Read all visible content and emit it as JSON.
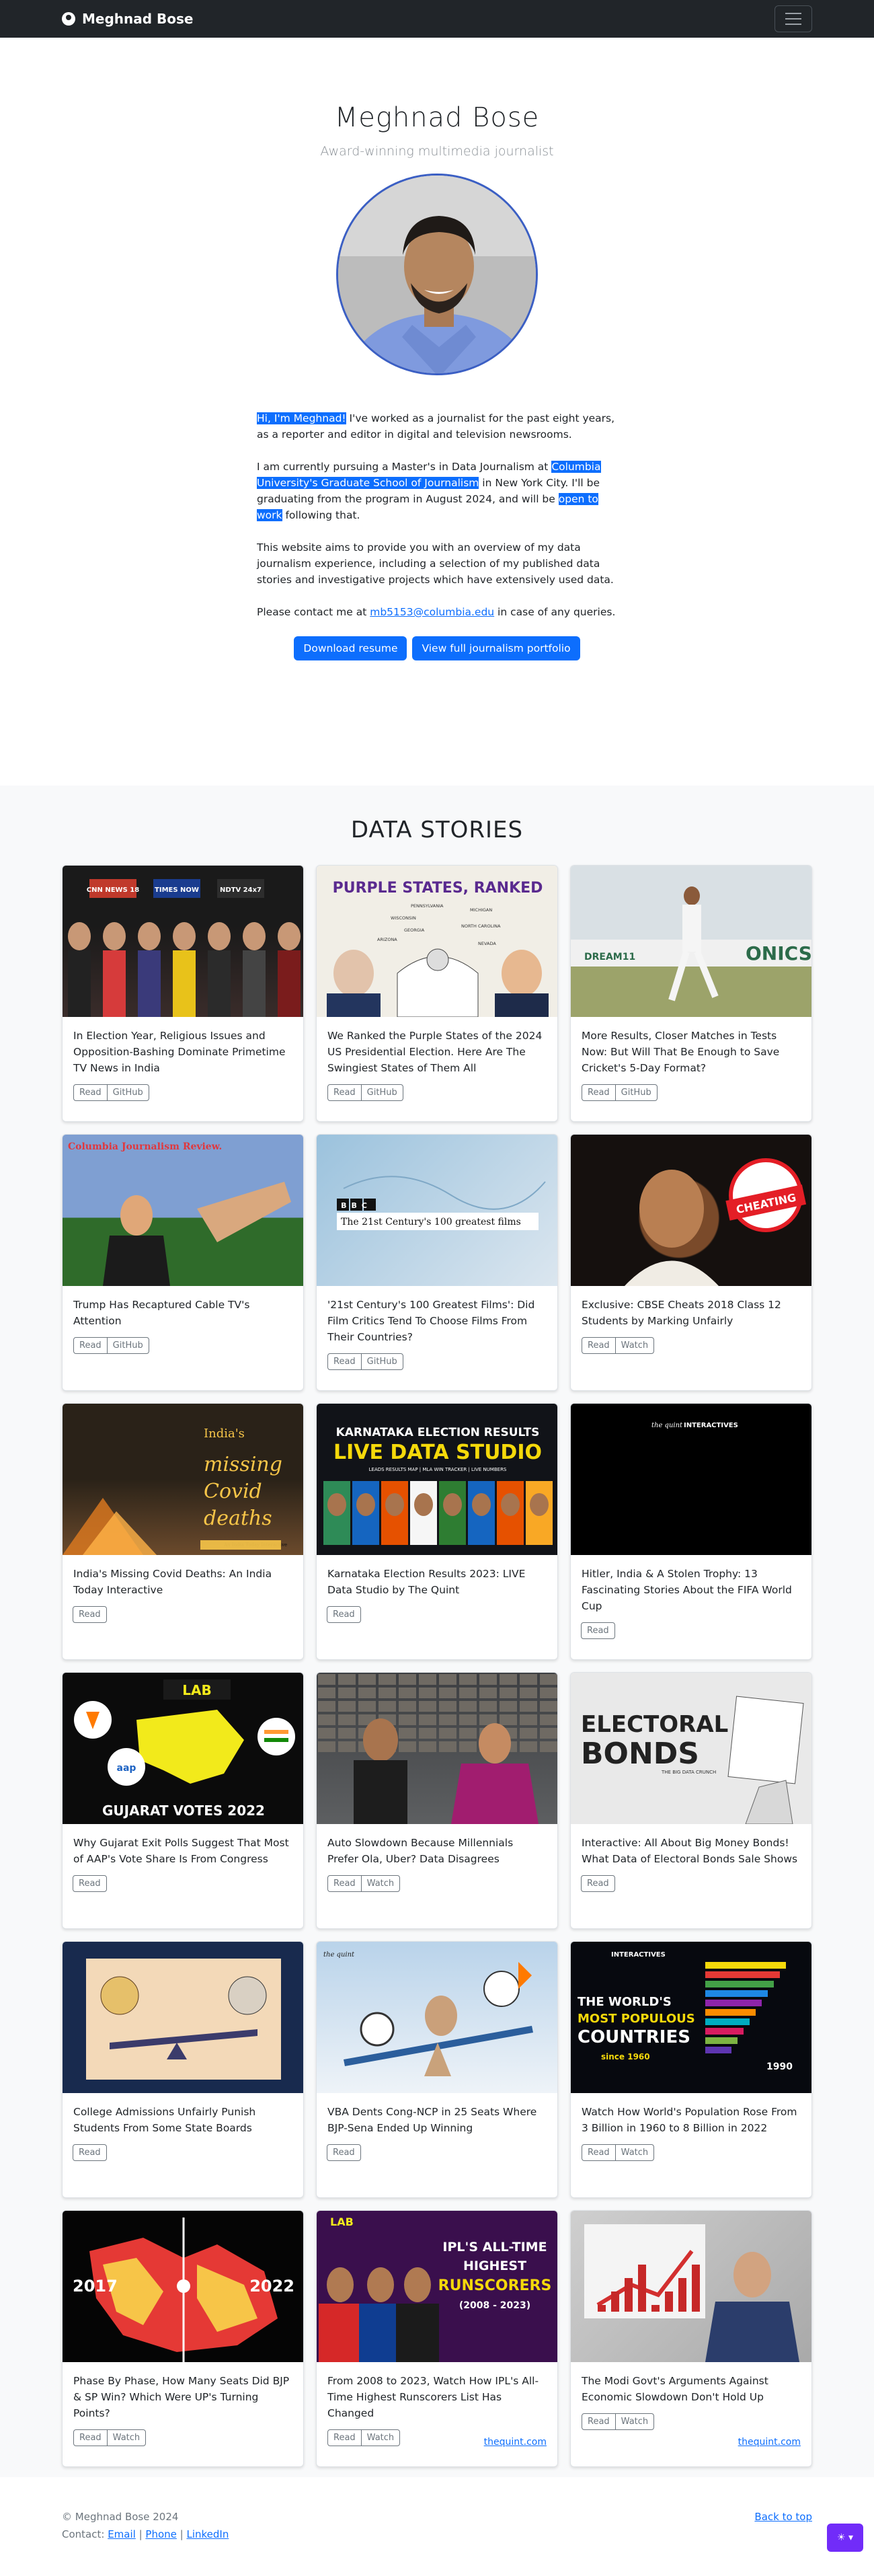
{
  "nav": {
    "brand": "Meghnad Bose"
  },
  "hero": {
    "name": "Meghnad Bose",
    "subtitle": "Award-winning multimedia journalist",
    "bio": {
      "p1_hl": "Hi, I'm Meghnad!",
      "p1_rest": " I've worked as a journalist for the past eight years, as a reporter and editor in digital and television newsrooms.",
      "p2_a": "I am currently pursuing a Master's in Data Journalism at ",
      "p2_hl1": "Columbia University's Graduate School of Journalism",
      "p2_b": " in New York City. I'll be graduating from the program in August 2024, and will be ",
      "p2_hl2": "open to work",
      "p2_c": " following that.",
      "p3": "This website aims to provide you with an overview of my data journalism experience, including a selection of my published data stories and investigative projects which have extensively used data.",
      "p4_a": "Please contact me at ",
      "p4_email": "mb5153@columbia.edu",
      "p4_b": " in case of any queries."
    },
    "buttons": {
      "resume": "Download resume",
      "portfolio": "View full journalism portfolio"
    }
  },
  "stories": {
    "heading": "DATA STORIES",
    "cards": [
      {
        "title": "In Election Year, Religious Issues and Opposition-Bashing Dominate Primetime TV News in India",
        "buttons": [
          "Read",
          "GitHub"
        ],
        "thumb_labels": [
          "CNN NEWS 18",
          "TIMES NOW",
          "NDTV 24x7"
        ]
      },
      {
        "title": "We Ranked the Purple States of the 2024 US Presidential Election. Here Are The Swingiest States of Them All",
        "buttons": [
          "Read",
          "GitHub"
        ],
        "thumb_labels": [
          "PURPLE STATES, RANKED",
          "PENNSYLVANIA",
          "MICHIGAN",
          "WISCONSIN",
          "NORTH CAROLINA",
          "GEORGIA",
          "ARIZONA",
          "NEVADA"
        ]
      },
      {
        "title": "More Results, Closer Matches in Tests Now: But Will That Be Enough to Save Cricket's 5-Day Format?",
        "buttons": [
          "Read",
          "GitHub"
        ],
        "thumb_labels": [
          "DREAM11",
          "ONICS"
        ]
      },
      {
        "title": "Trump Has Recaptured Cable TV's Attention",
        "buttons": [
          "Read",
          "GitHub"
        ],
        "thumb_labels": [
          "Columbia Journalism Review."
        ]
      },
      {
        "title": "'21st Century's 100 Greatest Films': Did Film Critics Tend To Choose Films From Their Countries?",
        "buttons": [
          "Read",
          "GitHub"
        ],
        "thumb_labels": [
          "BBC",
          "The 21st Century's 100 greatest films"
        ]
      },
      {
        "title": "Exclusive: CBSE Cheats 2018 Class 12 Students by Marking Unfairly",
        "buttons": [
          "Read",
          "Watch"
        ],
        "thumb_labels": [
          "CHEATING"
        ]
      },
      {
        "title": "India's Missing Covid Deaths: An India Today Interactive",
        "buttons": [
          "Read"
        ],
        "thumb_labels": [
          "India's",
          "missing",
          "Covid",
          "deaths",
          "An India Today Interactive"
        ]
      },
      {
        "title": "Karnataka Election Results 2023: LIVE Data Studio by The Quint",
        "buttons": [
          "Read"
        ],
        "thumb_labels": [
          "KARNATAKA ELECTION RESULTS",
          "LIVE DATA STUDIO",
          "LEADS RESULTS MAP | MLA WIN TRACKER | LIVE NUMBERS"
        ]
      },
      {
        "title": "Hitler, India & A Stolen Trophy: 13 Fascinating Stories About the FIFA World Cup",
        "buttons": [
          "Read"
        ],
        "thumb_labels": [
          "the quint",
          "INTERACTIVES"
        ]
      },
      {
        "title": "Why Gujarat Exit Polls Suggest That Most of AAP's Vote Share Is From Congress",
        "buttons": [
          "Read"
        ],
        "thumb_labels": [
          "LAB",
          "GUJARAT VOTES 2022",
          "aap"
        ]
      },
      {
        "title": "Auto Slowdown Because Millennials Prefer Ola, Uber? Data Disagrees",
        "buttons": [
          "Read",
          "Watch"
        ],
        "thumb_labels": []
      },
      {
        "title": "Interactive: All About Big Money Bonds! What Data of Electoral Bonds Sale Shows",
        "buttons": [
          "Read"
        ],
        "thumb_labels": [
          "ELECTORAL",
          "BONDS",
          "THE BIG DATA CRUNCH"
        ]
      },
      {
        "title": "College Admissions Unfairly Punish Students From Some State Boards",
        "buttons": [
          "Read"
        ],
        "thumb_labels": []
      },
      {
        "title": "VBA Dents Cong-NCP in 25 Seats Where BJP-Sena Ended Up Winning",
        "buttons": [
          "Read"
        ],
        "thumb_labels": [
          "the quint"
        ]
      },
      {
        "title": "Watch How World's Population Rose From 3 Billion in 1960 to 8 Billion in 2022",
        "buttons": [
          "Read",
          "Watch"
        ],
        "thumb_labels": [
          "INTERACTIVES",
          "THE WORLD'S",
          "MOST POPULOUS",
          "COUNTRIES",
          "since 1960",
          "1990"
        ]
      },
      {
        "title": "Phase By Phase, How Many Seats Did BJP & SP Win? Which Were UP's Turning Points?",
        "buttons": [
          "Read",
          "Watch"
        ],
        "thumb_labels": [
          "2017",
          "2022"
        ]
      },
      {
        "title": "From 2008 to 2023, Watch How IPL's All-Time Highest Runscorers List Has Changed",
        "buttons": [
          "Read",
          "Watch"
        ],
        "link": "thequint.com",
        "thumb_labels": [
          "LAB",
          "IPL'S ALL-TIME",
          "HIGHEST",
          "RUNSCORERS",
          "(2008 - 2023)"
        ]
      },
      {
        "title": "The Modi Govt's Arguments Against Economic Slowdown Don't Hold Up",
        "buttons": [
          "Read",
          "Watch"
        ],
        "link": "thequint.com",
        "thumb_labels": []
      }
    ]
  },
  "footer": {
    "copyright": "© Meghnad Bose 2024",
    "contact_label": "Contact: ",
    "links": [
      "Email",
      "Phone",
      "LinkedIn"
    ],
    "separator": " | ",
    "back_to_top": "Back to top"
  },
  "icons": {
    "theme_toggle": "sun-icon"
  },
  "colors": {
    "primary": "#0d6efd",
    "navbar": "#212529",
    "theme_button": "#712cf9"
  }
}
